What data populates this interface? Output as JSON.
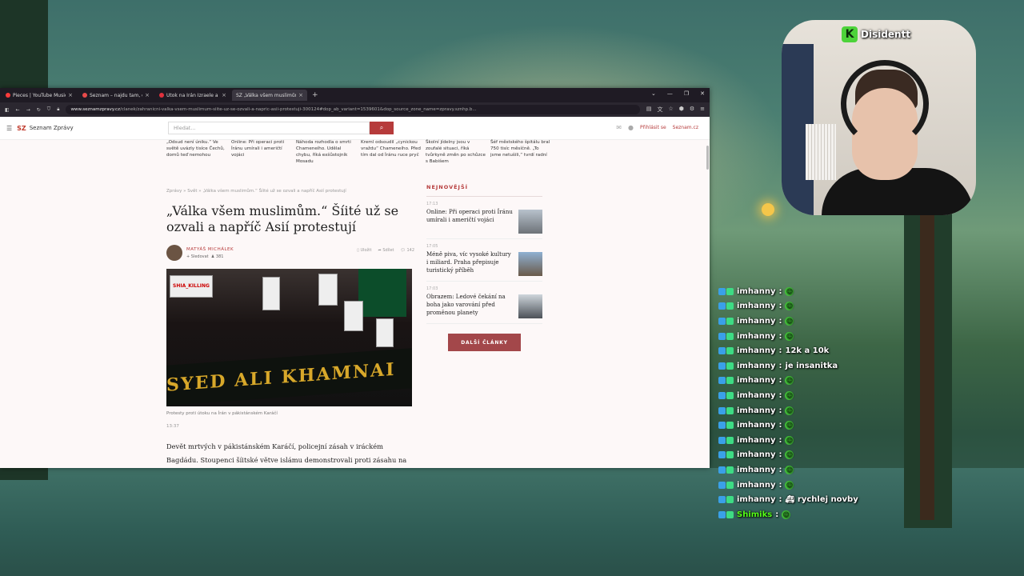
{
  "browser": {
    "tabs": [
      {
        "title": "Pieces | YouTube Music",
        "color": "#ff3b3b",
        "active": false
      },
      {
        "title": "Seznam – najdu tam, co nezná",
        "color": "#e84a4a",
        "active": false
      },
      {
        "title": "Útok na Írán Izraele a USA: Vál",
        "color": "#e0313d",
        "active": false
      },
      {
        "title": "SZ „Válka všem muslimům.“ Šíité u",
        "color": "#c0392b",
        "active": true
      }
    ],
    "url_domain": "www.seznamzpravy.cz",
    "url_path": "/clanek/zahranicni-valka-vsem-muslimum-siite-uz-se-ozvali-a-napric-asii-protestuji-300124#dop_ab_variant=1539601&dop_source_zone_name=zpravy.sznhp.b..."
  },
  "site": {
    "logo": "SZ",
    "brand": "Seznam Zprávy",
    "search_placeholder": "Hledat...",
    "login": "Přihlásit se",
    "seznam": "Seznam.cz"
  },
  "teasers": [
    "„Odsud není úniku.“ Ve světě uvázly tisíce Čechů, domů teď nemohou",
    "Online: Při operaci proti Íránu umírali i američtí vojáci",
    "Náhoda rozhodla o smrti Chameneího. Udělal chybu, říká exšůstojník Mosadu",
    "Kreml odsoudil „cynickou vraždu“ Chameneího. Před tím dal od Íránu ruce pryč",
    "Školní jídelny jsou v zoufalé situaci, říká tvůrkyně změn po schůzce s Babišem",
    "Šéf městského špitálu bral 750 tisíc měsíčně. „To jsme netušili,“ tvrdí radní"
  ],
  "article": {
    "breadcrumb": "Zprávy  »  Svět  »  „Válka všem muslimům.“ Šíité už se ozvali a napříč Asií protestují",
    "title": "„Válka všem muslimům.“ Šíité už se ozvali a napříč Asií protestují",
    "author": "MATYÁŠ MICHÁLEK",
    "follow": "+ Sledovat",
    "followers": "381",
    "action_save": "Uložit",
    "action_share": "Sdílet",
    "comments": "142",
    "photo_banner": "SYED ALI KHAMNAI",
    "photo_sign": "SHIA_KILLING",
    "caption": "Protesty proti útoku na Írán v pákistánském Karáčí",
    "time": "13:37",
    "lead": "Devět mrtvých v pákistánském Karáčí, policejní zásah v iráckém Bagdádu. Stoupenci šíitské větve islámu demonstrovali proti zásahu na"
  },
  "sidebar": {
    "heading": "NEJNOVĚJŠÍ",
    "items": [
      {
        "time": "17:13",
        "title": "Online: Při operaci proti Íránu umírali i američtí vojáci"
      },
      {
        "time": "17:05",
        "title": "Méně piva, víc vysoké kultury i miliard. Praha přepisuje turistický příběh"
      },
      {
        "time": "17:03",
        "title": "Obrazem: Ledové čekání na boha jako varování před proměnou planety"
      }
    ],
    "more_button": "DALŠÍ ČLÁNKY"
  },
  "stream": {
    "streamer": "Disidentt"
  },
  "chat": [
    {
      "user": "imhanny",
      "text": "",
      "emote": true
    },
    {
      "user": "imhanny",
      "text": "",
      "emote": true
    },
    {
      "user": "imhanny",
      "text": "",
      "emote": true
    },
    {
      "user": "imhanny",
      "text": "",
      "emote": true
    },
    {
      "user": "imhanny",
      "text": "12k a 10k",
      "emote": false
    },
    {
      "user": "imhanny",
      "text": "je insanitka",
      "emote": false
    },
    {
      "user": "imhanny",
      "text": "",
      "emote": true
    },
    {
      "user": "imhanny",
      "text": "",
      "emote": true
    },
    {
      "user": "imhanny",
      "text": "",
      "emote": true
    },
    {
      "user": "imhanny",
      "text": "",
      "emote": true
    },
    {
      "user": "imhanny",
      "text": "",
      "emote": true
    },
    {
      "user": "imhanny",
      "text": "",
      "emote": true
    },
    {
      "user": "imhanny",
      "text": "",
      "emote": true
    },
    {
      "user": "imhanny",
      "text": "",
      "emote": true
    },
    {
      "user": "imhanny",
      "text": "rychlej novby",
      "emote": false,
      "prefix_emote": true
    },
    {
      "user": "Shimiks",
      "text": "",
      "emote": true,
      "green": true
    }
  ]
}
